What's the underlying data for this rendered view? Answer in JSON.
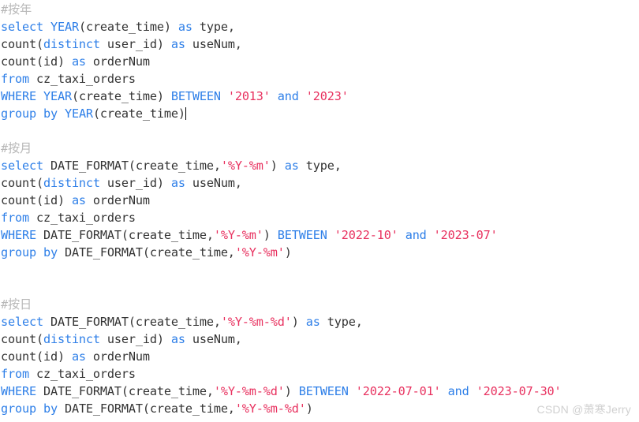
{
  "editor": {
    "background_color": "#ffffff",
    "syntax_colors": {
      "comment": "#b8b8b8",
      "keyword": "#2e7fe8",
      "plain": "#333333",
      "string": "#e8315f"
    },
    "lines": [
      {
        "type": "code",
        "tokens": [
          {
            "cls": "tok-comment",
            "text": "#按年"
          }
        ]
      },
      {
        "type": "code",
        "tokens": [
          {
            "cls": "tok-keyword",
            "text": "select "
          },
          {
            "cls": "tok-keyword",
            "text": "YEAR"
          },
          {
            "cls": "tok-plain",
            "text": "(create_time) "
          },
          {
            "cls": "tok-keyword",
            "text": "as "
          },
          {
            "cls": "tok-plain",
            "text": "type,"
          }
        ]
      },
      {
        "type": "code",
        "tokens": [
          {
            "cls": "tok-plain",
            "text": "count("
          },
          {
            "cls": "tok-keyword",
            "text": "distinct"
          },
          {
            "cls": "tok-plain",
            "text": " user_id) "
          },
          {
            "cls": "tok-keyword",
            "text": "as "
          },
          {
            "cls": "tok-plain",
            "text": "useNum,"
          }
        ]
      },
      {
        "type": "code",
        "tokens": [
          {
            "cls": "tok-plain",
            "text": "count(id) "
          },
          {
            "cls": "tok-keyword",
            "text": "as "
          },
          {
            "cls": "tok-plain",
            "text": "orderNum"
          }
        ]
      },
      {
        "type": "code",
        "tokens": [
          {
            "cls": "tok-keyword",
            "text": "from "
          },
          {
            "cls": "tok-plain",
            "text": "cz_taxi_orders"
          }
        ]
      },
      {
        "type": "code",
        "tokens": [
          {
            "cls": "tok-keyword",
            "text": "WHERE "
          },
          {
            "cls": "tok-keyword",
            "text": "YEAR"
          },
          {
            "cls": "tok-plain",
            "text": "(create_time) "
          },
          {
            "cls": "tok-keyword",
            "text": "BETWEEN "
          },
          {
            "cls": "tok-string",
            "text": "'2013'"
          },
          {
            "cls": "tok-keyword",
            "text": " and "
          },
          {
            "cls": "tok-string",
            "text": "'2023'"
          }
        ]
      },
      {
        "type": "code",
        "caret": true,
        "tokens": [
          {
            "cls": "tok-keyword",
            "text": "group "
          },
          {
            "cls": "tok-keyword",
            "text": "by "
          },
          {
            "cls": "tok-keyword",
            "text": "YEAR"
          },
          {
            "cls": "tok-plain",
            "text": "(create_time)"
          }
        ]
      },
      {
        "type": "blank",
        "tokens": []
      },
      {
        "type": "code",
        "tokens": [
          {
            "cls": "tok-comment",
            "text": "#按月"
          }
        ]
      },
      {
        "type": "code",
        "tokens": [
          {
            "cls": "tok-keyword",
            "text": "select "
          },
          {
            "cls": "tok-plain",
            "text": "DATE_FORMAT(create_time,"
          },
          {
            "cls": "tok-string",
            "text": "'%Y-%m'"
          },
          {
            "cls": "tok-plain",
            "text": ") "
          },
          {
            "cls": "tok-keyword",
            "text": "as "
          },
          {
            "cls": "tok-plain",
            "text": "type,"
          }
        ]
      },
      {
        "type": "code",
        "tokens": [
          {
            "cls": "tok-plain",
            "text": "count("
          },
          {
            "cls": "tok-keyword",
            "text": "distinct"
          },
          {
            "cls": "tok-plain",
            "text": " user_id) "
          },
          {
            "cls": "tok-keyword",
            "text": "as "
          },
          {
            "cls": "tok-plain",
            "text": "useNum,"
          }
        ]
      },
      {
        "type": "code",
        "tokens": [
          {
            "cls": "tok-plain",
            "text": "count(id) "
          },
          {
            "cls": "tok-keyword",
            "text": "as "
          },
          {
            "cls": "tok-plain",
            "text": "orderNum"
          }
        ]
      },
      {
        "type": "code",
        "tokens": [
          {
            "cls": "tok-keyword",
            "text": "from "
          },
          {
            "cls": "tok-plain",
            "text": "cz_taxi_orders"
          }
        ]
      },
      {
        "type": "code",
        "tokens": [
          {
            "cls": "tok-keyword",
            "text": "WHERE "
          },
          {
            "cls": "tok-plain",
            "text": "DATE_FORMAT(create_time,"
          },
          {
            "cls": "tok-string",
            "text": "'%Y-%m'"
          },
          {
            "cls": "tok-plain",
            "text": ") "
          },
          {
            "cls": "tok-keyword",
            "text": "BETWEEN "
          },
          {
            "cls": "tok-string",
            "text": "'2022-10'"
          },
          {
            "cls": "tok-keyword",
            "text": " and "
          },
          {
            "cls": "tok-string",
            "text": "'2023-07'"
          }
        ]
      },
      {
        "type": "code",
        "tokens": [
          {
            "cls": "tok-keyword",
            "text": "group "
          },
          {
            "cls": "tok-keyword",
            "text": "by "
          },
          {
            "cls": "tok-plain",
            "text": "DATE_FORMAT(create_time,"
          },
          {
            "cls": "tok-string",
            "text": "'%Y-%m'"
          },
          {
            "cls": "tok-plain",
            "text": ")"
          }
        ]
      },
      {
        "type": "blank",
        "tokens": []
      },
      {
        "type": "blank",
        "tokens": []
      },
      {
        "type": "code",
        "tokens": [
          {
            "cls": "tok-comment",
            "text": "#按日"
          }
        ]
      },
      {
        "type": "code",
        "tokens": [
          {
            "cls": "tok-keyword",
            "text": "select "
          },
          {
            "cls": "tok-plain",
            "text": "DATE_FORMAT(create_time,"
          },
          {
            "cls": "tok-string",
            "text": "'%Y-%m-%d'"
          },
          {
            "cls": "tok-plain",
            "text": ") "
          },
          {
            "cls": "tok-keyword",
            "text": "as "
          },
          {
            "cls": "tok-plain",
            "text": "type,"
          }
        ]
      },
      {
        "type": "code",
        "tokens": [
          {
            "cls": "tok-plain",
            "text": "count("
          },
          {
            "cls": "tok-keyword",
            "text": "distinct"
          },
          {
            "cls": "tok-plain",
            "text": " user_id) "
          },
          {
            "cls": "tok-keyword",
            "text": "as "
          },
          {
            "cls": "tok-plain",
            "text": "useNum,"
          }
        ]
      },
      {
        "type": "code",
        "tokens": [
          {
            "cls": "tok-plain",
            "text": "count(id) "
          },
          {
            "cls": "tok-keyword",
            "text": "as "
          },
          {
            "cls": "tok-plain",
            "text": "orderNum"
          }
        ]
      },
      {
        "type": "code",
        "tokens": [
          {
            "cls": "tok-keyword",
            "text": "from "
          },
          {
            "cls": "tok-plain",
            "text": "cz_taxi_orders"
          }
        ]
      },
      {
        "type": "code",
        "tokens": [
          {
            "cls": "tok-keyword",
            "text": "WHERE "
          },
          {
            "cls": "tok-plain",
            "text": "DATE_FORMAT(create_time,"
          },
          {
            "cls": "tok-string",
            "text": "'%Y-%m-%d'"
          },
          {
            "cls": "tok-plain",
            "text": ") "
          },
          {
            "cls": "tok-keyword",
            "text": "BETWEEN "
          },
          {
            "cls": "tok-string",
            "text": "'2022-07-01'"
          },
          {
            "cls": "tok-keyword",
            "text": " and "
          },
          {
            "cls": "tok-string",
            "text": "'2023-07-30'"
          }
        ]
      },
      {
        "type": "code",
        "tokens": [
          {
            "cls": "tok-keyword",
            "text": "group "
          },
          {
            "cls": "tok-keyword",
            "text": "by "
          },
          {
            "cls": "tok-plain",
            "text": "DATE_FORMAT(create_time,"
          },
          {
            "cls": "tok-string",
            "text": "'%Y-%m-%d'"
          },
          {
            "cls": "tok-plain",
            "text": ")"
          }
        ]
      }
    ]
  },
  "watermark": {
    "text": "CSDN @萧寒Jerry",
    "color": "#d0d0d0"
  }
}
